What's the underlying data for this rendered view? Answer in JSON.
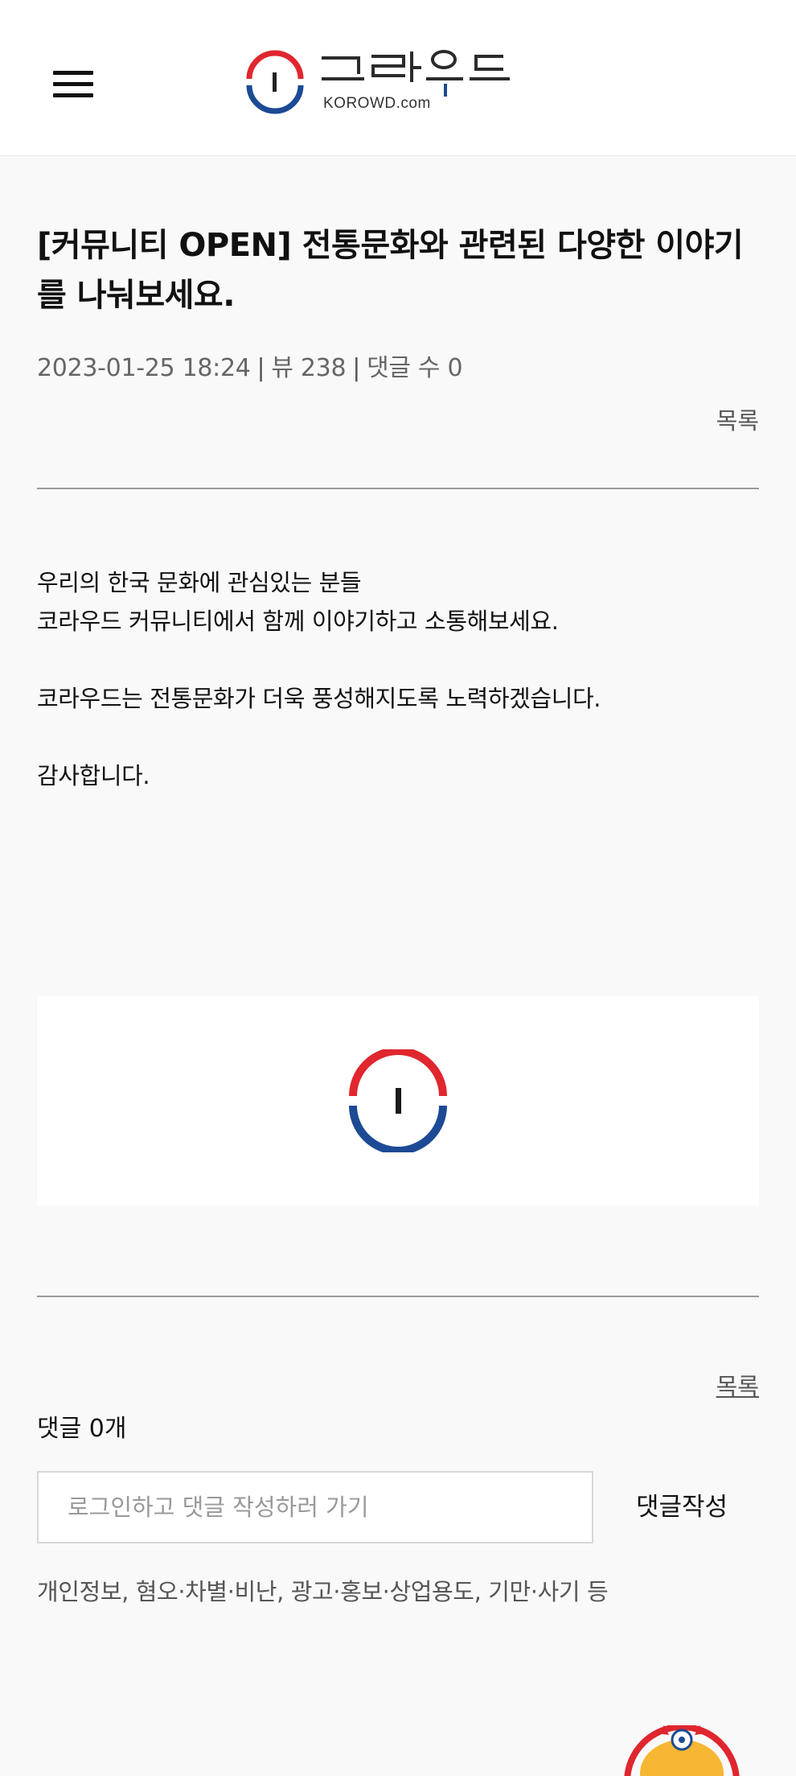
{
  "header": {
    "logo_text": "코라우드",
    "logo_sub": "KOROWD.com",
    "brand_colors": {
      "red": "#e0262e",
      "blue": "#1c4a94",
      "dark": "#222222"
    }
  },
  "post": {
    "title": "[커뮤니티 OPEN] 전통문화와 관련된 다양한 이야기를 나눠보세요.",
    "date": "2023-01-25 18:24",
    "views": "뷰 238",
    "comments_meta": "댓글 수 0",
    "list_label": "목록",
    "body": {
      "line1": "우리의 한국 문화에 관심있는 분들",
      "line2": "코라우드 커뮤니티에서 함께 이야기하고 소통해보세요.",
      "line3": "코라우드는 전통문화가 더욱 풍성해지도록 노력하겠습니다.",
      "line4": "감사합니다."
    }
  },
  "comments": {
    "count_label": "댓글 0개",
    "input_placeholder": "로그인하고 댓글 작성하러 가기",
    "submit_label": "댓글작성",
    "notice": "개인정보, 혐오·차별·비난, 광고·홍보·상업용도, 기만·사기 등"
  },
  "icons": {
    "menu": "hamburger-icon",
    "logo": "korowd-logo-icon",
    "image": "korowd-emblem-icon",
    "mascot": "mascot-character-icon"
  }
}
